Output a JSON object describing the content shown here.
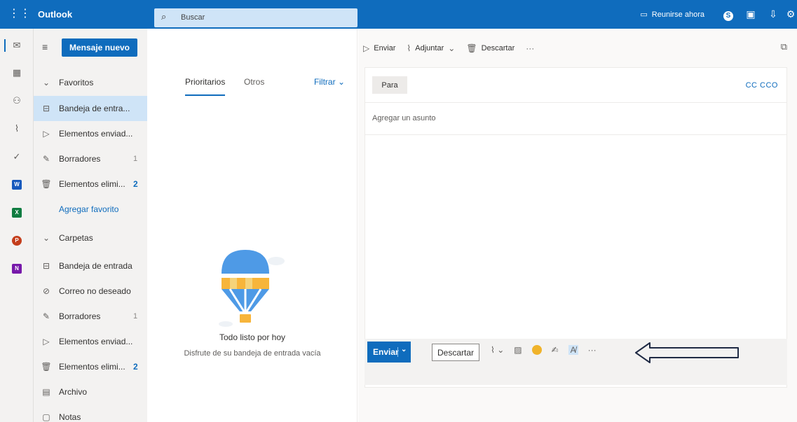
{
  "app": {
    "name": "Outlook",
    "accent": "#0f6cbd"
  },
  "search": {
    "placeholder": "Buscar"
  },
  "topbar": {
    "meet_now_label": "Reunirse ahora"
  },
  "rail": {
    "items": [
      "mail-icon",
      "calendar-icon",
      "people-icon",
      "attach-icon",
      "todo-icon",
      "word-icon",
      "excel-icon",
      "powerpoint-icon",
      "onenote-icon"
    ]
  },
  "folders": {
    "new_message_label": "Mensaje nuevo",
    "favorites_header": "Favoritos",
    "favorites": [
      {
        "label": "Bandeja de entra...",
        "count": ""
      },
      {
        "label": "Elementos enviad...",
        "count": ""
      },
      {
        "label": "Borradores",
        "count": "1"
      },
      {
        "label": "Elementos elimi...",
        "count": "2"
      }
    ],
    "add_favorite_label": "Agregar favorito",
    "folders_header": "Carpetas",
    "folders": [
      {
        "label": "Bandeja de entrada",
        "count": ""
      },
      {
        "label": "Correo no deseado",
        "count": ""
      },
      {
        "label": "Borradores",
        "count": "1"
      },
      {
        "label": "Elementos enviad...",
        "count": ""
      },
      {
        "label": "Elementos elimi...",
        "count": "2"
      },
      {
        "label": "Archivo",
        "count": ""
      },
      {
        "label": "Notas",
        "count": ""
      }
    ]
  },
  "list": {
    "tab_focused": "Prioritarios",
    "tab_other": "Otros",
    "filter_label": "Filtrar",
    "empty_title": "Todo listo por hoy",
    "empty_subtitle": "Disfrute de su bandeja de entrada vacía"
  },
  "compose": {
    "cmd_send": "Enviar",
    "cmd_attach": "Adjuntar",
    "cmd_discard": "Descartar",
    "to_label": "Para",
    "cc_label": "CC",
    "bcc_label": "CCO",
    "subject_placeholder": "Agregar un asunto",
    "send_label": "Enviar",
    "discard_label": "Descartar"
  }
}
